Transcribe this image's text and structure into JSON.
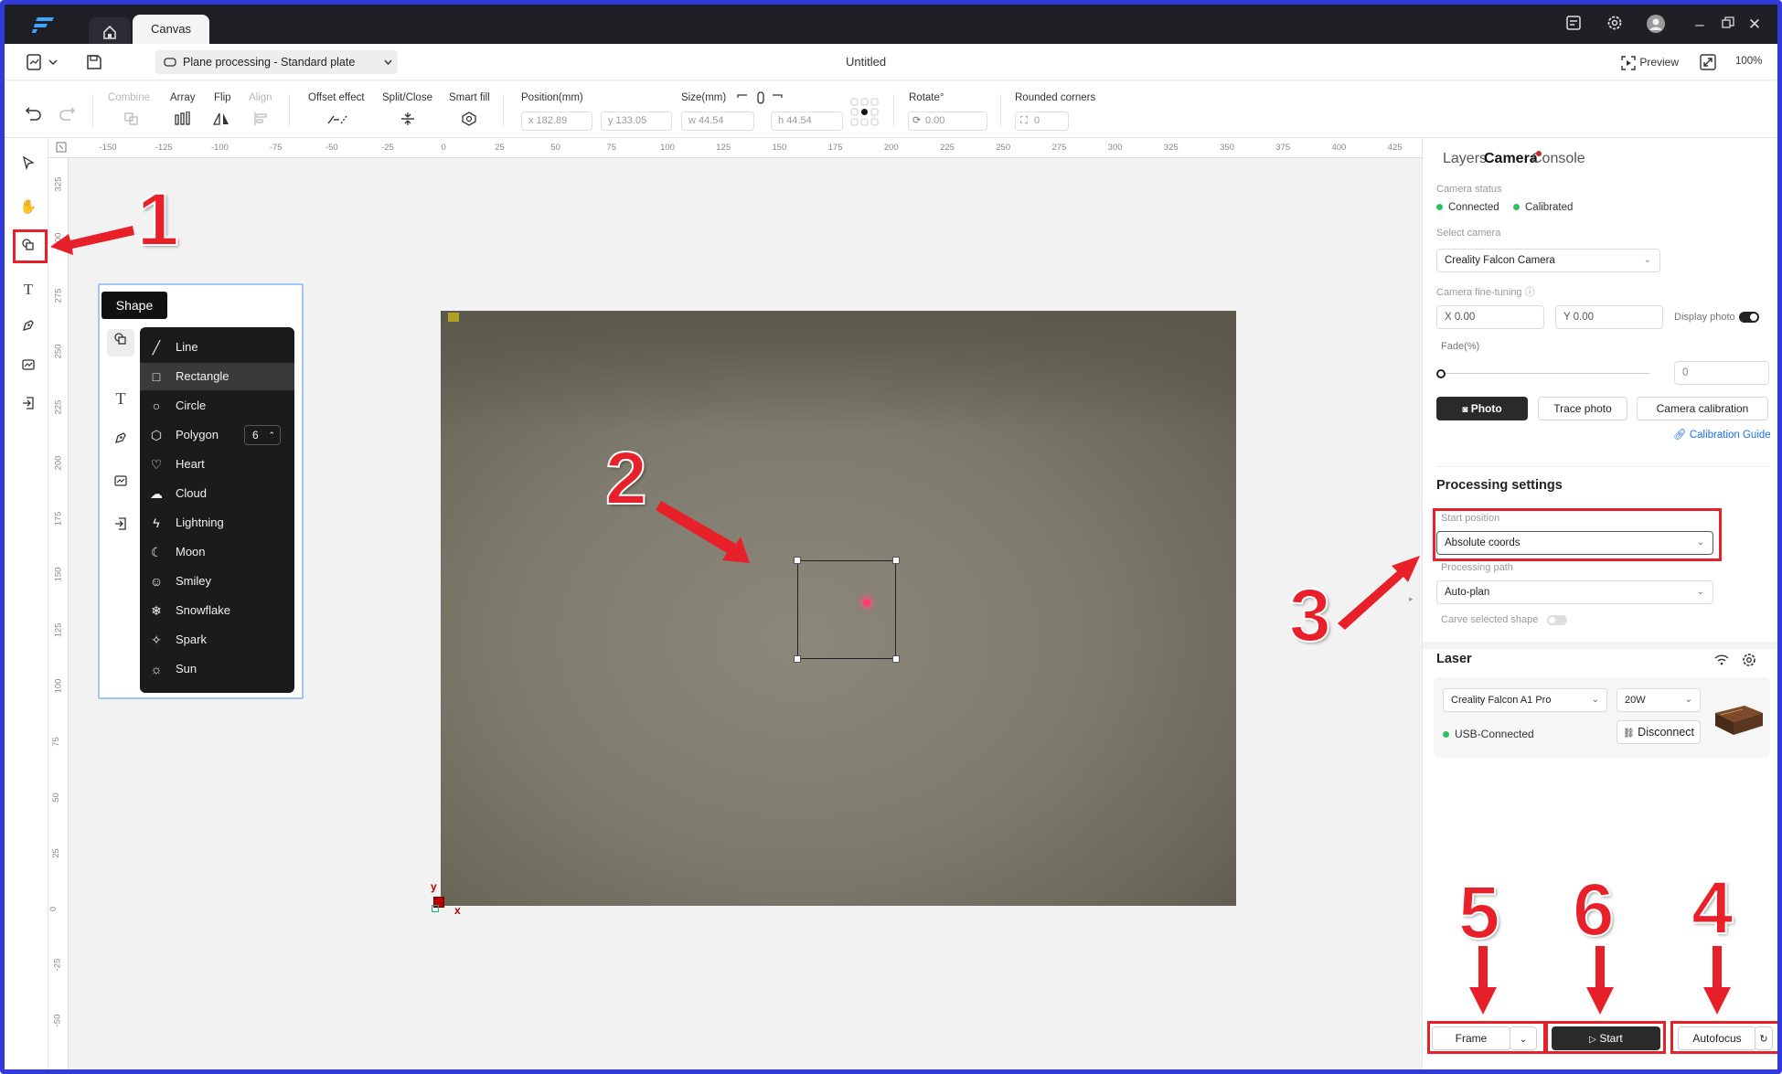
{
  "titlebar": {
    "canvas_tab": "Canvas"
  },
  "menubar": {
    "plate": "Plane processing - Standard plate",
    "doc_title": "Untitled",
    "preview": "Preview",
    "zoom": "100%"
  },
  "toolbar": {
    "combine": "Combine",
    "array": "Array",
    "flip": "Flip",
    "align": "Align",
    "offset": "Offset effect",
    "split": "Split/Close",
    "smartfill": "Smart fill",
    "position_label": "Position(mm)",
    "pos_x": "x 182.89",
    "pos_y": "y 133.05",
    "size_label": "Size(mm)",
    "size_w": "w 44.54",
    "size_h": "h 44.54",
    "rotate_label": "Rotate°",
    "rotate_value": "0.00",
    "corners_label": "Rounded corners",
    "corners_value": "0"
  },
  "ruler": {
    "h": [
      "-150",
      "-125",
      "-100",
      "-75",
      "-50",
      "-25",
      "0",
      "25",
      "50",
      "75",
      "100",
      "125",
      "150",
      "175",
      "200",
      "225",
      "250",
      "275",
      "300",
      "325",
      "350",
      "375",
      "400",
      "425"
    ],
    "v": [
      "325",
      "300",
      "275",
      "250",
      "225",
      "200",
      "175",
      "150",
      "125",
      "100",
      "75",
      "50",
      "25",
      "0",
      "-25",
      "-50"
    ]
  },
  "canvas": {
    "axis_x": "x",
    "axis_y": "y"
  },
  "shape_popup": {
    "tooltip": "Shape",
    "items": [
      {
        "label": "Line",
        "icon": "line-icon"
      },
      {
        "label": "Rectangle",
        "icon": "rectangle-icon"
      },
      {
        "label": "Circle",
        "icon": "circle-icon"
      },
      {
        "label": "Polygon",
        "icon": "polygon-icon"
      },
      {
        "label": "Heart",
        "icon": "heart-icon"
      },
      {
        "label": "Cloud",
        "icon": "cloud-icon"
      },
      {
        "label": "Lightning",
        "icon": "lightning-icon"
      },
      {
        "label": "Moon",
        "icon": "moon-icon"
      },
      {
        "label": "Smiley",
        "icon": "smiley-icon"
      },
      {
        "label": "Snowflake",
        "icon": "snowflake-icon"
      },
      {
        "label": "Spark",
        "icon": "spark-icon"
      },
      {
        "label": "Sun",
        "icon": "sun-icon"
      }
    ],
    "polygon_sides": "6"
  },
  "right_panel": {
    "tabs": {
      "layers": "Layers",
      "camera": "Camera",
      "console": "Console"
    },
    "camera_status_label": "Camera status",
    "connected": "Connected",
    "calibrated": "Calibrated",
    "select_camera_label": "Select camera",
    "camera_name": "Creality Falcon Camera",
    "fine_tuning_label": "Camera fine-tuning",
    "fine_x": "X 0.00",
    "fine_y": "Y 0.00",
    "display_photo": "Display photo",
    "fade_label": "Fade(%)",
    "fade_value": "0",
    "photo_btn": "Photo",
    "trace_btn": "Trace photo",
    "calibration_btn": "Camera calibration",
    "calibration_guide": "Calibration Guide",
    "processing_title": "Processing settings",
    "start_position_label": "Start position",
    "start_position_value": "Absolute coords",
    "processing_path_label": "Processing path",
    "processing_path_value": "Auto-plan",
    "carve_label": "Carve selected shape",
    "laser_title": "Laser",
    "laser_model": "Creality Falcon A1 Pro",
    "laser_power": "20W",
    "usb_status": "USB-Connected",
    "disconnect": "Disconnect"
  },
  "bottom": {
    "frame": "Frame",
    "start": "Start",
    "autofocus": "Autofocus"
  },
  "annotations": [
    "1",
    "2",
    "3",
    "4",
    "5",
    "6"
  ],
  "colors": {
    "annotation": "#e8202a",
    "accent_dark": "#2a2a2a",
    "status_green": "#30c060",
    "link_blue": "#1a73e8"
  }
}
